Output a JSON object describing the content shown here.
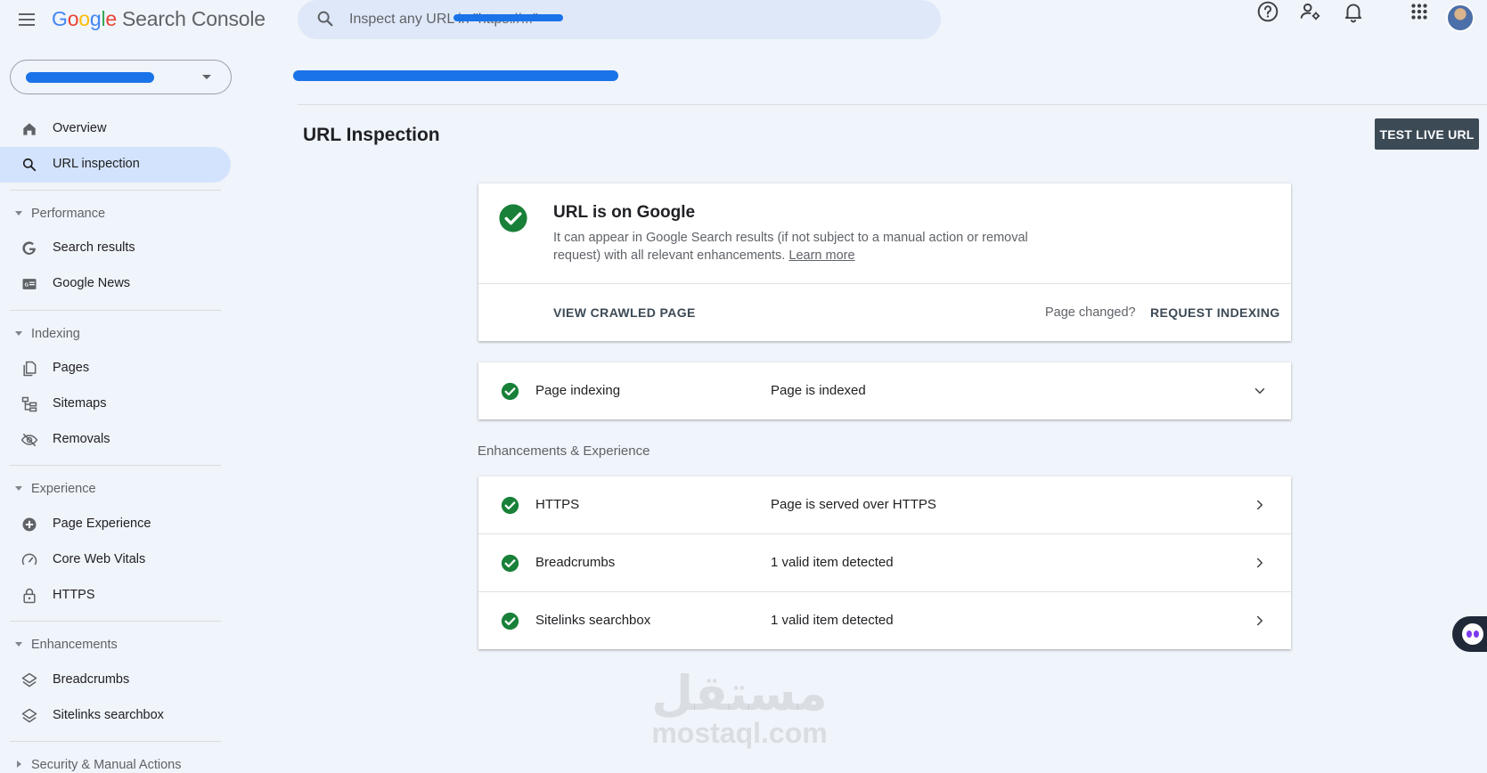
{
  "app": {
    "logo_letters": [
      "G",
      "o",
      "o",
      "g",
      "l",
      "e"
    ],
    "logo_suffix": "Search Console"
  },
  "search": {
    "placeholder": "Inspect any URL in \"https://...\""
  },
  "header_icons": [
    "help-icon",
    "manage-users-icon",
    "notifications-icon",
    "apps-grid-icon",
    "account-avatar"
  ],
  "sidebar": {
    "top_items": [
      {
        "label": "Overview",
        "icon": "home-icon"
      },
      {
        "label": "URL inspection",
        "icon": "search-icon",
        "active": true
      }
    ],
    "sections": [
      {
        "label": "Performance",
        "expanded": true,
        "items": [
          {
            "label": "Search results",
            "icon": "google-g-icon"
          },
          {
            "label": "Google News",
            "icon": "news-icon"
          }
        ]
      },
      {
        "label": "Indexing",
        "expanded": true,
        "items": [
          {
            "label": "Pages",
            "icon": "pages-icon"
          },
          {
            "label": "Sitemaps",
            "icon": "sitemap-icon"
          },
          {
            "label": "Removals",
            "icon": "visibility-off-icon"
          }
        ]
      },
      {
        "label": "Experience",
        "expanded": true,
        "items": [
          {
            "label": "Page Experience",
            "icon": "plus-circle-icon"
          },
          {
            "label": "Core Web Vitals",
            "icon": "speedometer-icon"
          },
          {
            "label": "HTTPS",
            "icon": "lock-icon"
          }
        ]
      },
      {
        "label": "Enhancements",
        "expanded": true,
        "items": [
          {
            "label": "Breadcrumbs",
            "icon": "layers-icon"
          },
          {
            "label": "Sitelinks searchbox",
            "icon": "layers-icon"
          }
        ]
      },
      {
        "label": "Security & Manual Actions",
        "expanded": false,
        "items": []
      }
    ]
  },
  "main": {
    "title": "URL Inspection",
    "test_live_url": "TEST LIVE URL",
    "status": {
      "title": "URL is on Google",
      "description": "It can appear in Google Search results (if not subject to a manual action or removal request) with all relevant enhancements.",
      "learn_more": "Learn more",
      "view_crawled": "VIEW CRAWLED PAGE",
      "page_changed": "Page changed?",
      "request_indexing": "REQUEST INDEXING"
    },
    "indexing_row": {
      "name": "Page indexing",
      "value": "Page is indexed"
    },
    "enhancements_label": "Enhancements & Experience",
    "enhancement_rows": [
      {
        "name": "HTTPS",
        "value": "Page is served over HTTPS"
      },
      {
        "name": "Breadcrumbs",
        "value": "1 valid item detected"
      },
      {
        "name": "Sitelinks searchbox",
        "value": "1 valid item detected"
      }
    ]
  },
  "watermark": {
    "arabic": "مستقل",
    "latin": "mostaql.com"
  },
  "colors": {
    "check_green": "#188038",
    "accent_blue": "#1a73e8",
    "active_nav": "#d3e3fd",
    "button_dark": "#3c4a56"
  }
}
